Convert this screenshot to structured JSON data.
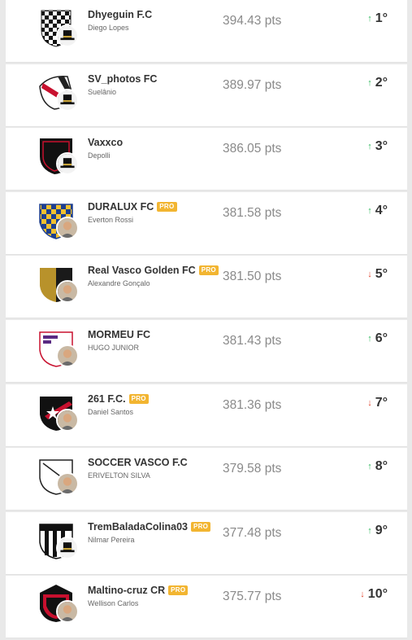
{
  "pts_suffix": "pts",
  "colors": {
    "up": "#2eb85c",
    "down": "#e0452d",
    "pro_badge": "#f2b531"
  },
  "rows": [
    {
      "team": "Dhyeguin F.C",
      "owner": "Diego Lopes",
      "pro": false,
      "pts": "394.43 pts",
      "trend": "up",
      "position": "1°",
      "crest": "checkered-black-white",
      "avatar": "top-hat"
    },
    {
      "team": "SV_photos FC",
      "owner": "Suelânio",
      "pro": false,
      "pts": "389.97 pts",
      "trend": "up",
      "position": "2°",
      "crest": "red-black-sash",
      "avatar": "top-hat"
    },
    {
      "team": "Vaxxco",
      "owner": "Depolli",
      "pro": false,
      "pts": "386.05 pts",
      "trend": "up",
      "position": "3°",
      "crest": "black-red-shield",
      "avatar": "top-hat"
    },
    {
      "team": "DURALUX FC",
      "owner": "Everton Rossi",
      "pro": true,
      "pts": "381.58 pts",
      "trend": "up",
      "position": "4°",
      "crest": "blue-gold-check",
      "avatar": "photo"
    },
    {
      "team": "Real Vasco Golden FC",
      "owner": "Alexandre Gonçalo",
      "pro": true,
      "pts": "381.50 pts",
      "trend": "down",
      "position": "5°",
      "crest": "gold-black-shield",
      "avatar": "photo"
    },
    {
      "team": "MORMEU FC",
      "owner": "HUGO JUNIOR",
      "pro": false,
      "pts": "381.43 pts",
      "trend": "up",
      "position": "6°",
      "crest": "white-purple-shield",
      "avatar": "photo"
    },
    {
      "team": "261 F.C.",
      "owner": "Daniel Santos",
      "pro": true,
      "pts": "381.36 pts",
      "trend": "down",
      "position": "7°",
      "crest": "black-star-shield",
      "avatar": "photo"
    },
    {
      "team": "SOCCER VASCO F.C",
      "owner": "ERIVELTON SILVA",
      "pro": false,
      "pts": "379.58 pts",
      "trend": "up",
      "position": "8°",
      "crest": "white-outline-shield",
      "avatar": "photo"
    },
    {
      "team": "TremBaladaColina03",
      "owner": "Nilmar Pereira",
      "pro": true,
      "pts": "377.48 pts",
      "trend": "up",
      "position": "9°",
      "crest": "black-white-stripes",
      "avatar": "top-hat"
    },
    {
      "team": "Maltino-cruz CR",
      "owner": "Wellison Carlos",
      "pro": true,
      "pts": "375.77 pts",
      "trend": "down",
      "position": "10°",
      "crest": "black-red-round",
      "avatar": "photo"
    }
  ]
}
